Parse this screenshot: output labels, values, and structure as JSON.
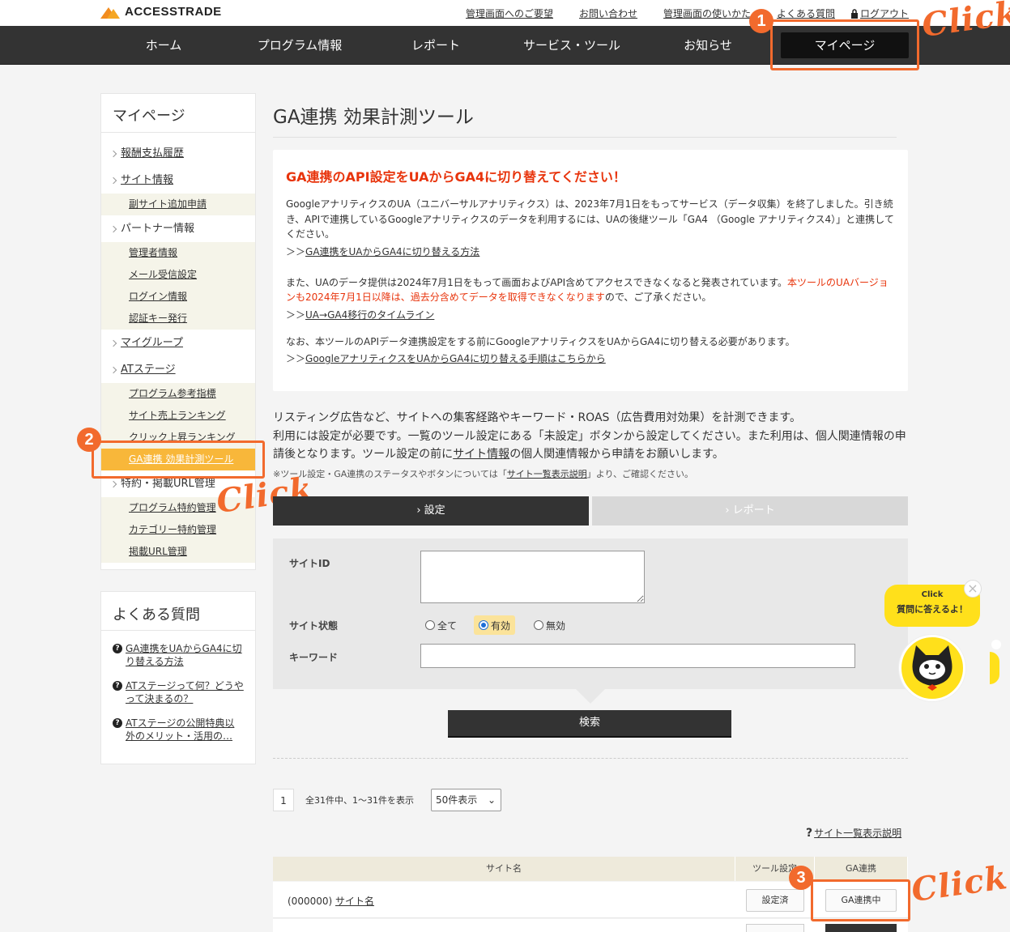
{
  "header": {
    "logo_text": "ACCESSTRADE",
    "links": [
      "管理画面へのご要望",
      "お問い合わせ",
      "管理画面の使いかた",
      "よくある質問"
    ],
    "logout": "ログアウト"
  },
  "nav": {
    "items": [
      "ホーム",
      "プログラム情報",
      "レポート",
      "サービス・ツール",
      "お知らせ",
      "マイページ"
    ],
    "active": "マイページ"
  },
  "annotations": {
    "num1": "1",
    "num2": "2",
    "num3": "3",
    "click": "Click"
  },
  "sidebar": {
    "title": "マイページ",
    "items": [
      {
        "label": "報酬支払履歴",
        "level": 1
      },
      {
        "label": "サイト情報",
        "level": 1
      },
      {
        "label": "副サイト追加申請",
        "level": 2
      },
      {
        "label": "パートナー情報",
        "level": 1
      },
      {
        "label": "管理者情報",
        "level": 2
      },
      {
        "label": "メール受信設定",
        "level": 2
      },
      {
        "label": "ログイン情報",
        "level": 2
      },
      {
        "label": "認証キー発行",
        "level": 2
      },
      {
        "label": "マイグループ",
        "level": 1
      },
      {
        "label": "ATステージ",
        "level": 1
      },
      {
        "label": "プログラム参考指標",
        "level": 2
      },
      {
        "label": "サイト売上ランキング",
        "level": 2
      },
      {
        "label": "クリック上昇ランキング",
        "level": 2
      },
      {
        "label": "GA連携 効果計測ツール",
        "level": 2
      },
      {
        "label": "特約・掲載URL管理",
        "level": 1
      },
      {
        "label": "プログラム特約管理",
        "level": 2
      },
      {
        "label": "カテゴリー特約管理",
        "level": 2
      },
      {
        "label": "掲載URL管理",
        "level": 2
      }
    ]
  },
  "faq": {
    "title": "よくある質問",
    "items": [
      "GA連携をUAからGA4に切り替える方法",
      "ATステージって何？どうやって決まるの？",
      "ATステージの公開特典以外のメリット・活用の…"
    ]
  },
  "main": {
    "title": "GA連携 効果計測ツール",
    "notice": {
      "heading": "GA連携のAPI設定をUAからGA4に切り替えてください！",
      "p1": "GoogleアナリティクスのUA（ユニバーサルアナリティクス）は、2023年7月1日をもってサービス（データ収集）を終了しました。引き続き、APIで連携しているGoogleアナリティクスのデータを利用するには、UAの後継ツール「GA4 （Google アナリティクス4）」と連携してください。",
      "link1_prefix": "＞＞",
      "link1": "GA連携をUAからGA4に切り替える方法",
      "p2_a": "また、UAのデータ提供は2024年7月1日をもって画面およびAPI含めてアクセスできなくなると発表されています。",
      "p2_red": "本ツールのUAバージョンも2024年7月1日以降は、過去分含めてデータを取得できなくなります",
      "p2_b": "ので、ご了承ください。",
      "link2_prefix": "＞＞",
      "link2": "UA→GA4移行のタイムライン",
      "p3": "なお、本ツールのAPIデータ連携設定をする前にGoogleアナリティクスをUAからGA4に切り替える必要があります。",
      "link3_prefix": "＞＞",
      "link3": "GoogleアナリティクスをUAからGA4に切り替える手順はこちらから"
    },
    "intro_1": "リスティング広告など、サイトへの集客経路やキーワード・ROAS（広告費用対効果）を計測できます。",
    "intro_2a": "利用には設定が必要です。一覧のツール設定にある「未設定」ボタンから設定してください。また利用は、個人関連情報の申請後となります。ツール設定の前に",
    "intro_2_link": "サイト情報",
    "intro_2b": "の個人関連情報から申請をお願いします。",
    "note_a": "※ツール設定・GA連携のステータスやボタンについては「",
    "note_link": "サイト一覧表示説明",
    "note_b": "」より、ご確認ください。",
    "tabs": [
      "設定",
      "レポート"
    ],
    "form": {
      "site_id_label": "サイトID",
      "status_label": "サイト状態",
      "status_options": [
        "全て",
        "有効",
        "無効"
      ],
      "status_selected": "有効",
      "keyword_label": "キーワード",
      "search_button": "検索"
    },
    "pagination": {
      "page": "1",
      "info": "全31件中、1～31件を表示",
      "per_page": "50件表示"
    },
    "help_link": "サイト一覧表示説明",
    "table": {
      "headers": [
        "サイト名",
        "ツール設定",
        "GA連携"
      ],
      "row": {
        "site_id": "(000000)",
        "site_name": "サイト名",
        "tool_status": "設定済",
        "ga_status": "GA連携中"
      }
    }
  },
  "chat": {
    "line1": "Click",
    "line2": "質問に答えるよ！",
    "close": "×"
  },
  "colors": {
    "accent": "#f26a2d",
    "nav_bg": "#333333",
    "notice_red": "#e8340c",
    "highlight": "#f8b73a"
  }
}
